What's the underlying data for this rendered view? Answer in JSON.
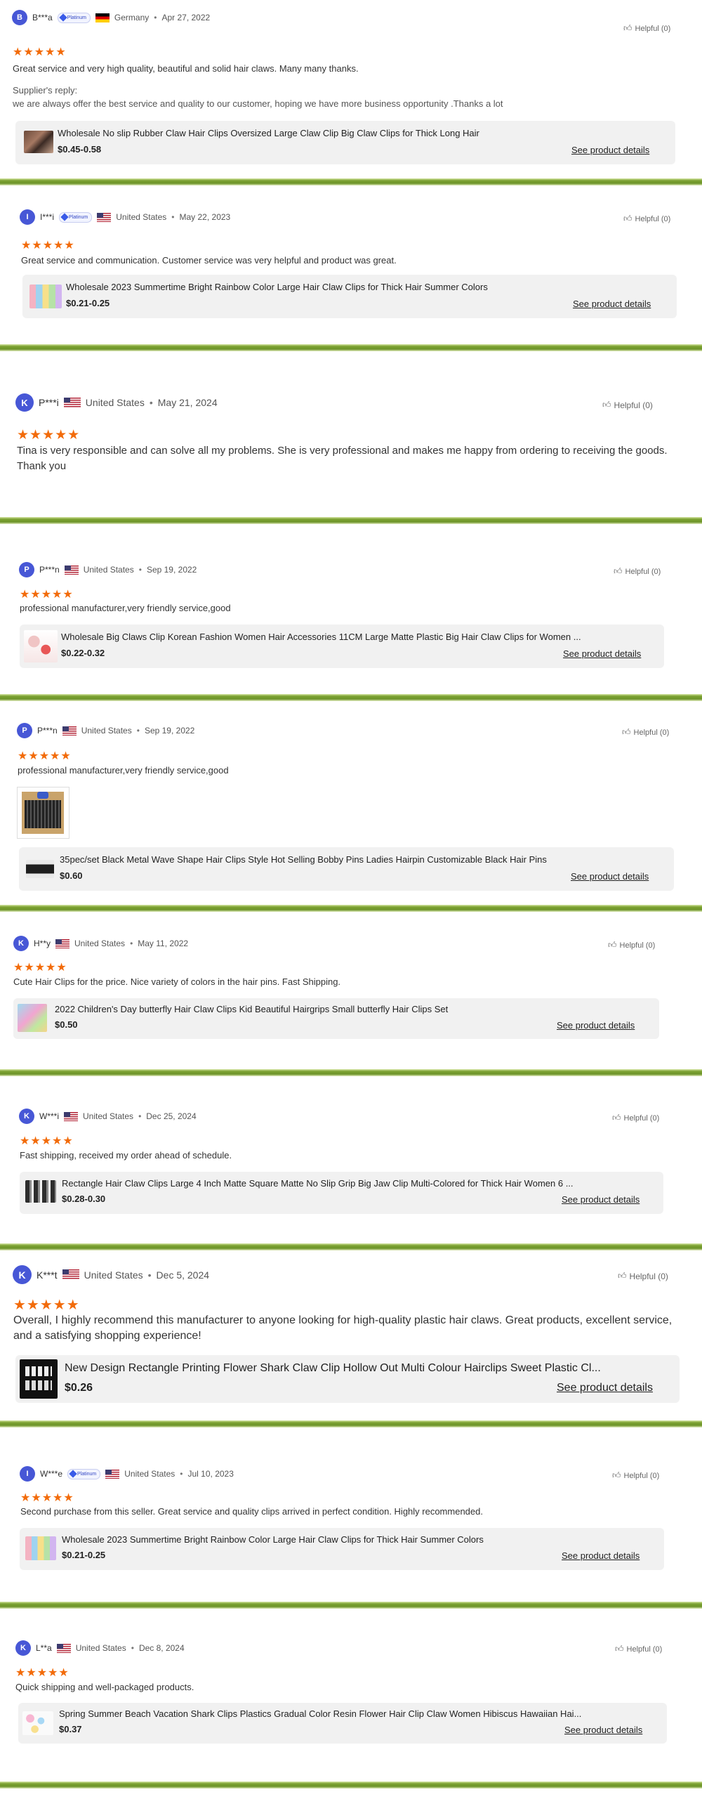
{
  "helpful_label": "Helpful (0)",
  "reviews": [
    {
      "initial": "B",
      "name": "B***a",
      "platinum": true,
      "country": "Germany",
      "date": "Apr 27, 2022",
      "text": "Great service and very high quality, beautiful and solid hair claws. Many many thanks.",
      "reply_label": "Supplier's reply:",
      "reply_text": "we are always offer the best service and quality to our customer, hoping we have more business opportunity .Thanks a lot",
      "product": {
        "title": "Wholesale No slip Rubber Claw Hair Clips Oversized Large Claw Clip Big Claw Clips for Thick Long Hair",
        "price": "$0.45-0.58",
        "link": "See product details"
      }
    },
    {
      "initial": "I",
      "name": "I***i",
      "platinum": true,
      "country": "United States",
      "date": "May 22, 2023",
      "text": "Great service and communication. Customer service was very helpful and product was great.",
      "product": {
        "title": "Wholesale 2023 Summertime Bright Rainbow Color Large Hair Claw Clips for Thick Hair Summer Colors",
        "price": "$0.21-0.25",
        "link": "See product details"
      }
    },
    {
      "initial": "K",
      "name": "P***i",
      "platinum": false,
      "country": "United States",
      "date": "May 21, 2024",
      "text": "Tina is very responsible and can solve all my problems. She is very professional and makes me happy from ordering to receiving the goods. Thank you"
    },
    {
      "initial": "P",
      "name": "P***n",
      "platinum": false,
      "country": "United States",
      "date": "Sep 19, 2022",
      "text": "professional manufacturer,very friendly service,good",
      "product": {
        "title": "Wholesale Big Claws Clip Korean Fashion Women Hair Accessories 11CM Large Matte Plastic Big Hair Claw Clips for Women ...",
        "price": "$0.22-0.32",
        "link": "See product details"
      }
    },
    {
      "initial": "P",
      "name": "P***n",
      "platinum": false,
      "country": "United States",
      "date": "Sep 19, 2022",
      "text": "professional manufacturer,very friendly service,good",
      "product": {
        "title": "35pec/set Black Metal Wave Shape Hair Clips Style Hot Selling Bobby Pins Ladies Hairpin Customizable Black Hair Pins",
        "price": "$0.60",
        "link": "See product details"
      }
    },
    {
      "initial": "K",
      "name": "H**y",
      "platinum": false,
      "country": "United States",
      "date": "May 11, 2022",
      "text": "Cute Hair Clips for the price. Nice variety of colors in the hair pins. Fast Shipping.",
      "product": {
        "title": "2022 Children's Day butterfly Hair Claw Clips Kid Beautiful Hairgrips Small butterfly Hair Clips Set",
        "price": "$0.50",
        "link": "See product details"
      }
    },
    {
      "initial": "K",
      "name": "W***i",
      "platinum": false,
      "country": "United States",
      "date": "Dec 25, 2024",
      "text": "Fast shipping, received my order ahead of schedule.",
      "product": {
        "title": "Rectangle Hair Claw Clips Large 4 Inch Matte Square Matte No Slip Grip Big Jaw Clip Multi-Colored for Thick Hair Women 6 ...",
        "price": "$0.28-0.30",
        "link": "See product details"
      }
    },
    {
      "initial": "K",
      "name": "K***t",
      "platinum": false,
      "country": "United States",
      "date": "Dec 5, 2024",
      "text": "Overall, I highly recommend this manufacturer to anyone looking for high-quality plastic hair claws. Great products, excellent service, and a satisfying shopping experience!",
      "product": {
        "title": "New Design Rectangle Printing Flower Shark Claw Clip Hollow Out Multi Colour Hairclips Sweet Plastic Cl...",
        "price": "$0.26",
        "link": "See product details"
      }
    },
    {
      "initial": "I",
      "name": "W***e",
      "platinum": true,
      "country": "United States",
      "date": "Jul 10, 2023",
      "text": "Second purchase from this seller. Great service and quality clips arrived in perfect condition. Highly recommended.",
      "product": {
        "title": "Wholesale 2023 Summertime Bright Rainbow Color Large Hair Claw Clips for Thick Hair Summer Colors",
        "price": "$0.21-0.25",
        "link": "See product details"
      }
    },
    {
      "initial": "K",
      "name": "L**a",
      "platinum": false,
      "country": "United States",
      "date": "Dec 8, 2024",
      "text": "Quick shipping and well-packaged products.",
      "product": {
        "title": "Spring Summer Beach Vacation Shark Clips Plastics Gradual Color Resin Flower Hair Clip Claw Women Hibiscus Hawaiian Hai...",
        "price": "$0.37",
        "link": "See product details"
      }
    }
  ],
  "badge_label": "Platinum",
  "rating_stars": "★★★★★",
  "colors": {
    "accent_star": "#f26b0a",
    "avatar": "#4757d6",
    "separator": "#7da332"
  },
  "icons": {
    "helpful": "thumbs-up-icon",
    "badge": "platinum-diamond-icon"
  }
}
